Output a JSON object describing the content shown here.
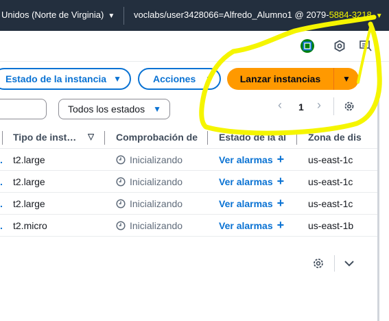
{
  "topbar": {
    "region": "Unidos (Norte de Virginia)",
    "account_prefix": "voclabs/user3428066=Alfredo_Alumno1 @ 2079-",
    "account_highlight": "5884-3218"
  },
  "icons": {
    "cloudshell": "cloudshell-icon",
    "gear": "gear-icon",
    "feedback": "feedback-icon"
  },
  "toolbar": {
    "instance_state_label": "Estado de la instancia",
    "actions_label": "Acciones",
    "launch_label": "Lanzar instancias"
  },
  "filter": {
    "state_select": "Todos los estados"
  },
  "pagination": {
    "page": "1"
  },
  "table": {
    "columns": [
      "Tipo de inst…",
      "Comprobación de",
      "Estado de la ala",
      "Zona de dis"
    ],
    "rows": [
      {
        "type": "t2.large",
        "status": "Inicializando",
        "alarm": "Ver alarmas",
        "zone": "us-east-1c"
      },
      {
        "type": "t2.large",
        "status": "Inicializando",
        "alarm": "Ver alarmas",
        "zone": "us-east-1c"
      },
      {
        "type": "t2.large",
        "status": "Inicializando",
        "alarm": "Ver alarmas",
        "zone": "us-east-1c"
      },
      {
        "type": "t2.micro",
        "status": "Inicializando",
        "alarm": "Ver alarmas",
        "zone": "us-east-1b"
      }
    ]
  },
  "colors": {
    "topbar_bg": "#232f3e",
    "link_blue": "#0972d3",
    "launch_orange": "#ff9900",
    "annotation_yellow": "#f5f500",
    "cloudshell_green": "#037f0c"
  }
}
